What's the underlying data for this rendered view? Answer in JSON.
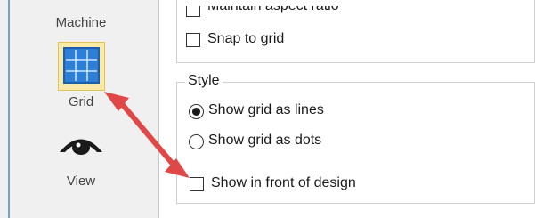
{
  "sidebar": {
    "machine_label": "Machine",
    "grid_label": "Grid",
    "view_label": "View"
  },
  "options": {
    "maintain_aspect_ratio": {
      "label": "Maintain aspect ratio",
      "checked": false
    },
    "snap_to_grid": {
      "label": "Snap to grid",
      "checked": false
    }
  },
  "style_group": {
    "title": "Style",
    "show_grid_as_lines": {
      "label": "Show grid as lines",
      "selected": true
    },
    "show_grid_as_dots": {
      "label": "Show grid as dots",
      "selected": false
    },
    "show_in_front_of_design": {
      "label": "Show in front of design",
      "checked": false
    }
  },
  "colors": {
    "annotation_arrow": "#e04848",
    "grid_icon_fill": "#2d7fd6",
    "grid_button_highlight": "#fbe9a8"
  }
}
